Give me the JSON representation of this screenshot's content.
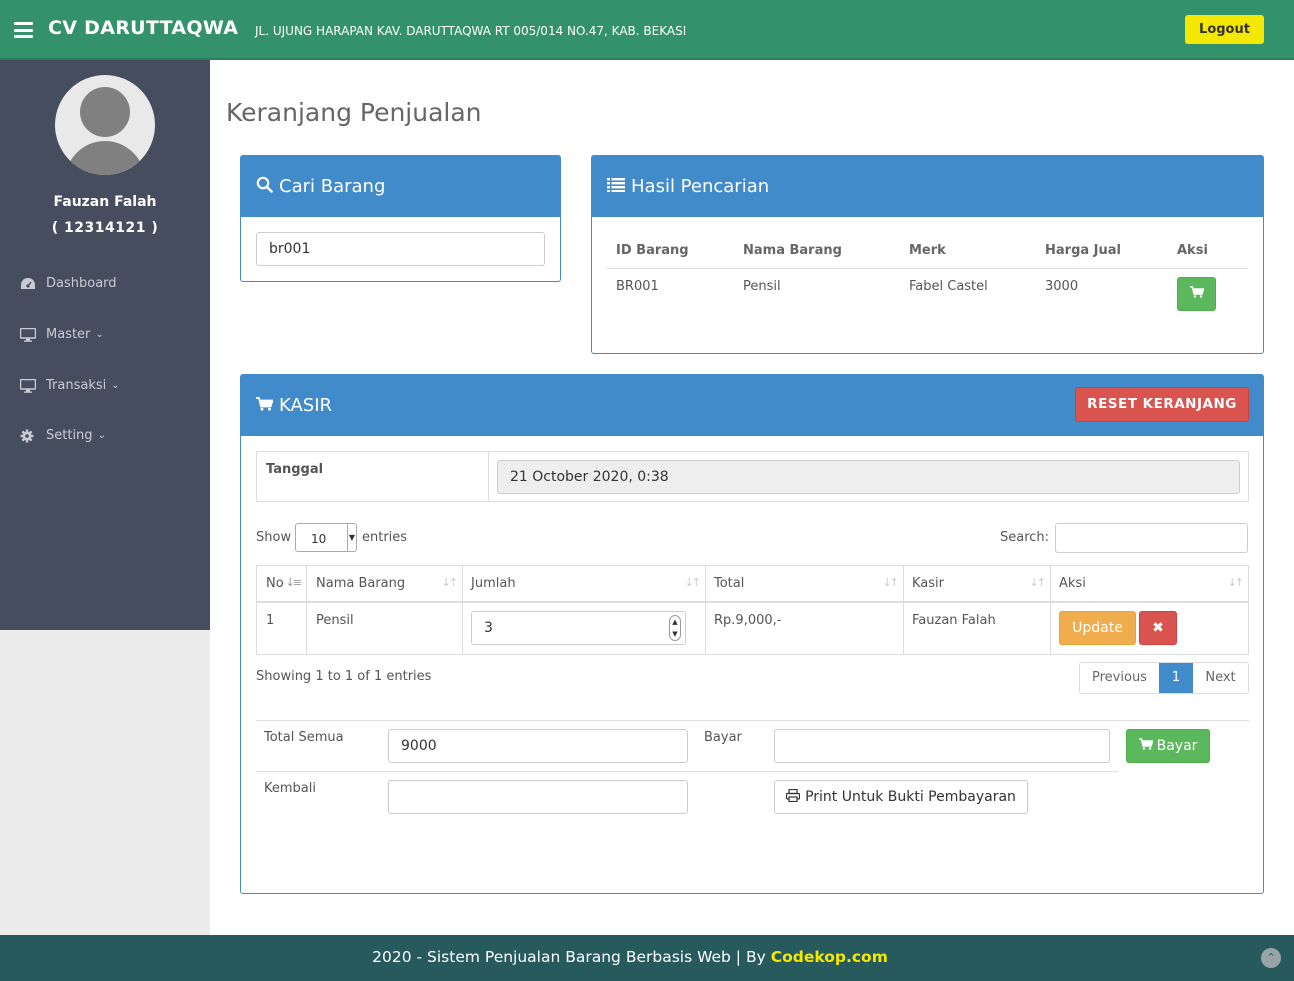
{
  "header": {
    "brand": "CV DARUTTAQWA",
    "address": "JL. UJUNG HARAPAN KAV. DARUTTAQWA RT 005/014 NO.47, KAB. BEKASI",
    "logout_label": "Logout"
  },
  "sidebar": {
    "user_name": "Fauzan Falah",
    "user_id": "( 12314121 )",
    "items": [
      {
        "label": "Dashboard",
        "icon": "dashboard-icon"
      },
      {
        "label": "Master",
        "icon": "desktop-icon"
      },
      {
        "label": "Transaksi",
        "icon": "desktop-icon"
      },
      {
        "label": "Setting",
        "icon": "gear-icon"
      }
    ]
  },
  "page_title": "Keranjang Penjualan",
  "search_panel": {
    "title": "Cari Barang",
    "input_value": "br001"
  },
  "results_panel": {
    "title": "Hasil Pencarian",
    "columns": [
      "ID Barang",
      "Nama Barang",
      "Merk",
      "Harga Jual",
      "Aksi"
    ],
    "rows": [
      {
        "id": "BR001",
        "nama": "Pensil",
        "merk": "Fabel Castel",
        "harga": "3000"
      }
    ]
  },
  "kasir": {
    "title": "KASIR",
    "reset_label": "RESET KERANJANG",
    "tanggal_label": "Tanggal",
    "tanggal_value": "21 October 2020, 0:38",
    "show_label": "Show",
    "entries_value": "10",
    "entries_label": "entries",
    "search_label": "Search:",
    "columns": [
      "No",
      "Nama Barang",
      "Jumlah",
      "Total",
      "Kasir",
      "Aksi"
    ],
    "rows": [
      {
        "no": "1",
        "nama": "Pensil",
        "jumlah": "3",
        "total": "Rp.9,000,-",
        "kasir": "Fauzan Falah",
        "update_label": "Update"
      }
    ],
    "showing": "Showing 1 to 1 of 1 entries",
    "pagination": {
      "previous": "Previous",
      "page": "1",
      "next": "Next"
    },
    "total_semua_label": "Total Semua",
    "total_semua_value": "9000",
    "bayar_label": "Bayar",
    "bayar_button": "Bayar",
    "kembali_label": "Kembali",
    "print_label": "Print Untuk Bukti Pembayaran"
  },
  "footer": {
    "text": "2020 - Sistem Penjualan Barang Berbasis Web | By ",
    "link": "Codekop.com"
  }
}
